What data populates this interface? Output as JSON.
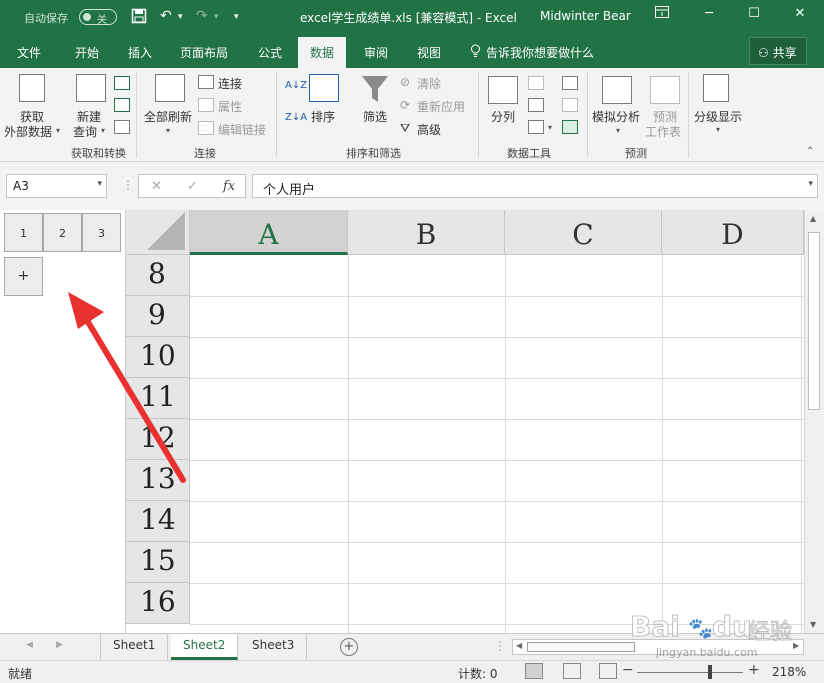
{
  "titlebar": {
    "autosave_label": "自动保存",
    "autosave_state": "关",
    "title": "excel学生成绩单.xls  [兼容模式]  -  Excel",
    "user": "Midwinter Bear"
  },
  "tabs": [
    "文件",
    "开始",
    "插入",
    "页面布局",
    "公式",
    "数据",
    "审阅",
    "视图"
  ],
  "active_tab": "数据",
  "tell_me": "告诉我你想要做什么",
  "share_label": "共享",
  "ribbon": {
    "get_external": "获取",
    "get_external_2": "外部数据",
    "new_query": "新建",
    "new_query_2": "查询",
    "group_get_transform": "获取和转换",
    "refresh_all": "全部刷新",
    "connections": "连接",
    "properties": "属性",
    "edit_links": "编辑链接",
    "group_connections": "连接",
    "sort": "排序",
    "filter": "筛选",
    "clear": "清除",
    "reapply": "重新应用",
    "advanced": "高级",
    "group_sort_filter": "排序和筛选",
    "text_to_columns": "分列",
    "group_data_tools": "数据工具",
    "what_if": "模拟分析",
    "forecast_sheet": "预测",
    "forecast_sheet_2": "工作表",
    "group_forecast": "预测",
    "outline": "分级显示",
    "sort_az": "A↓Z",
    "sort_za": "Z↓A"
  },
  "formula_bar": {
    "name_box": "A3",
    "formula": "个人用户",
    "fx": "fx"
  },
  "outline": {
    "levels": [
      "1",
      "2",
      "3"
    ],
    "expand": "+"
  },
  "grid": {
    "columns": [
      "A",
      "B",
      "C",
      "D"
    ],
    "selected_column": "A",
    "rows": [
      "8",
      "9",
      "10",
      "11",
      "12",
      "13",
      "14",
      "15",
      "16"
    ]
  },
  "sheets": [
    "Sheet1",
    "Sheet2",
    "Sheet3"
  ],
  "active_sheet": "Sheet2",
  "status": {
    "ready": "就绪",
    "count": "计数: 0",
    "zoom": "218%"
  },
  "watermark": {
    "brand": "Bai",
    "brand_2": "du",
    "brand_cn": "经验",
    "url": "jingyan.baidu.com"
  },
  "colors": {
    "excel_green": "#217346",
    "arrow": "#e8322f"
  }
}
